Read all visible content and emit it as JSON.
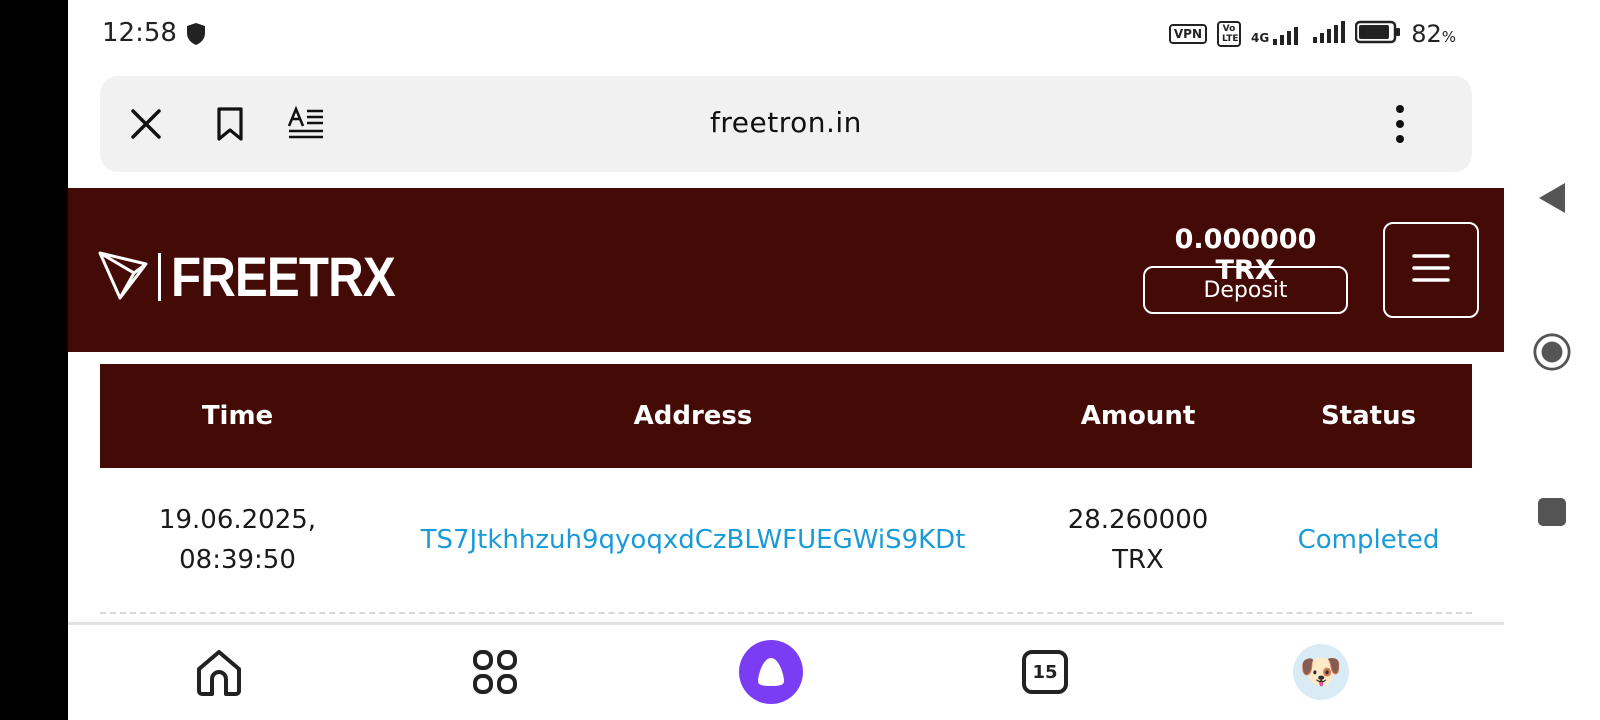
{
  "status_bar": {
    "time": "12:58",
    "badges": [
      "VPN",
      "Vo LTE",
      "4G"
    ],
    "battery_percent": "82",
    "battery_suffix": "%"
  },
  "browser": {
    "url": "freetron.in",
    "icons": [
      "close-icon",
      "bookmark-icon",
      "reader-mode-icon",
      "more-vertical-icon"
    ]
  },
  "site": {
    "logo_text": "FREETRX",
    "balance": "0.000000 TRX",
    "deposit_label": "Deposit"
  },
  "table": {
    "headers": [
      "Time",
      "Address",
      "Amount",
      "Status"
    ],
    "rows": [
      {
        "time_line1": "19.06.2025,",
        "time_line2": "08:39:50",
        "address": "TS7Jtkhhzuh9qyoqxdCzBLWFUEGWiS9KDt",
        "amount_line1": "28.260000",
        "amount_line2": "TRX",
        "status": "Completed"
      }
    ]
  },
  "bottom_bar": {
    "tabs_count": "15",
    "items": [
      "home-icon",
      "apps-grid-icon",
      "alice-assistant-icon",
      "tabs-count-icon",
      "avatar"
    ]
  },
  "colors": {
    "brand_dark": "#440a06",
    "link": "#1a9bd7",
    "assistant": "#7b3df3"
  }
}
